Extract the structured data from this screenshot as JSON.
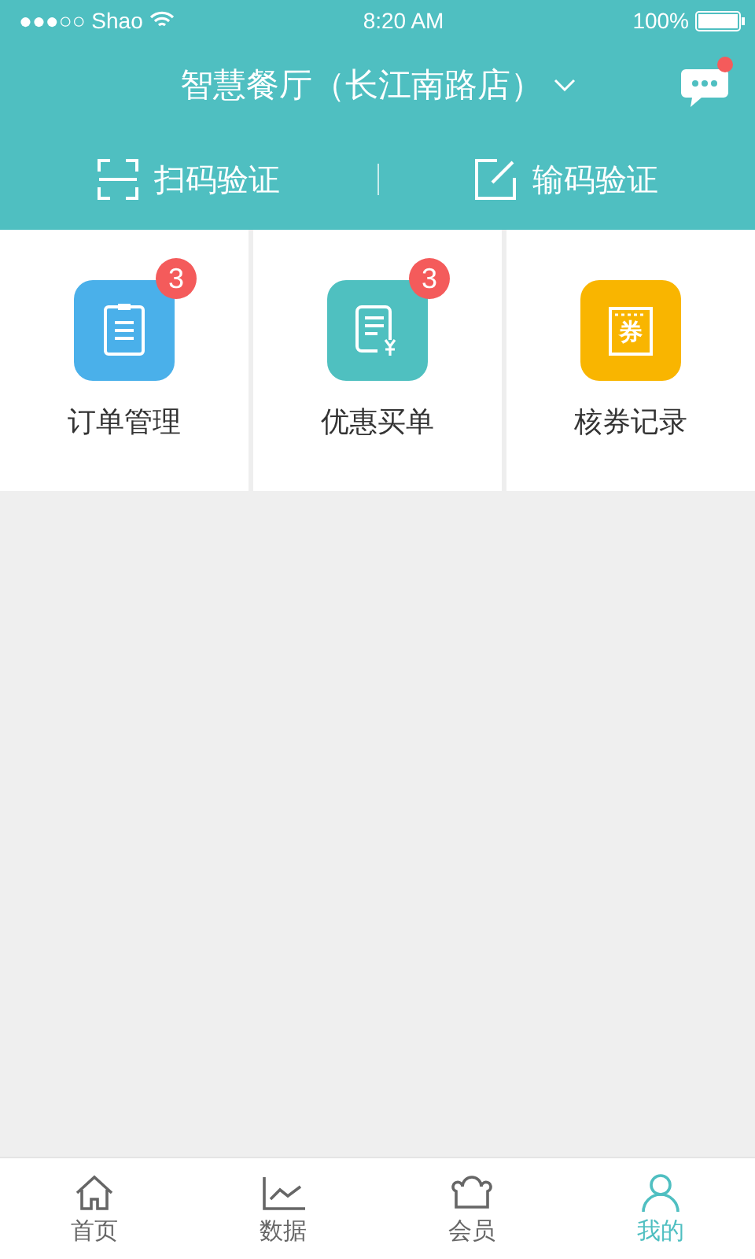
{
  "status_bar": {
    "carrier": "●●●○○ Shao",
    "time": "8:20 AM",
    "battery": "100%"
  },
  "header": {
    "title": "智慧餐厅（长江南路店）",
    "has_unread": true
  },
  "actions": [
    {
      "kind": "scan",
      "label": "扫码验证"
    },
    {
      "kind": "input",
      "label": "输码验证"
    }
  ],
  "tiles": [
    {
      "kind": "orders",
      "label": "订单管理",
      "badge": "3",
      "color": "#4ab0ea"
    },
    {
      "kind": "discount",
      "label": "优惠买单",
      "badge": "3",
      "color": "#4fc0c0"
    },
    {
      "kind": "coupon",
      "label": "核券记录",
      "icon_text": "券",
      "color": "#f9b500"
    }
  ],
  "tab_bar": [
    {
      "kind": "home",
      "label": "首页",
      "selected": false
    },
    {
      "kind": "data",
      "label": "数据",
      "selected": false
    },
    {
      "kind": "member",
      "label": "会员",
      "selected": false
    },
    {
      "kind": "mine",
      "label": "我的",
      "selected": true
    }
  ]
}
